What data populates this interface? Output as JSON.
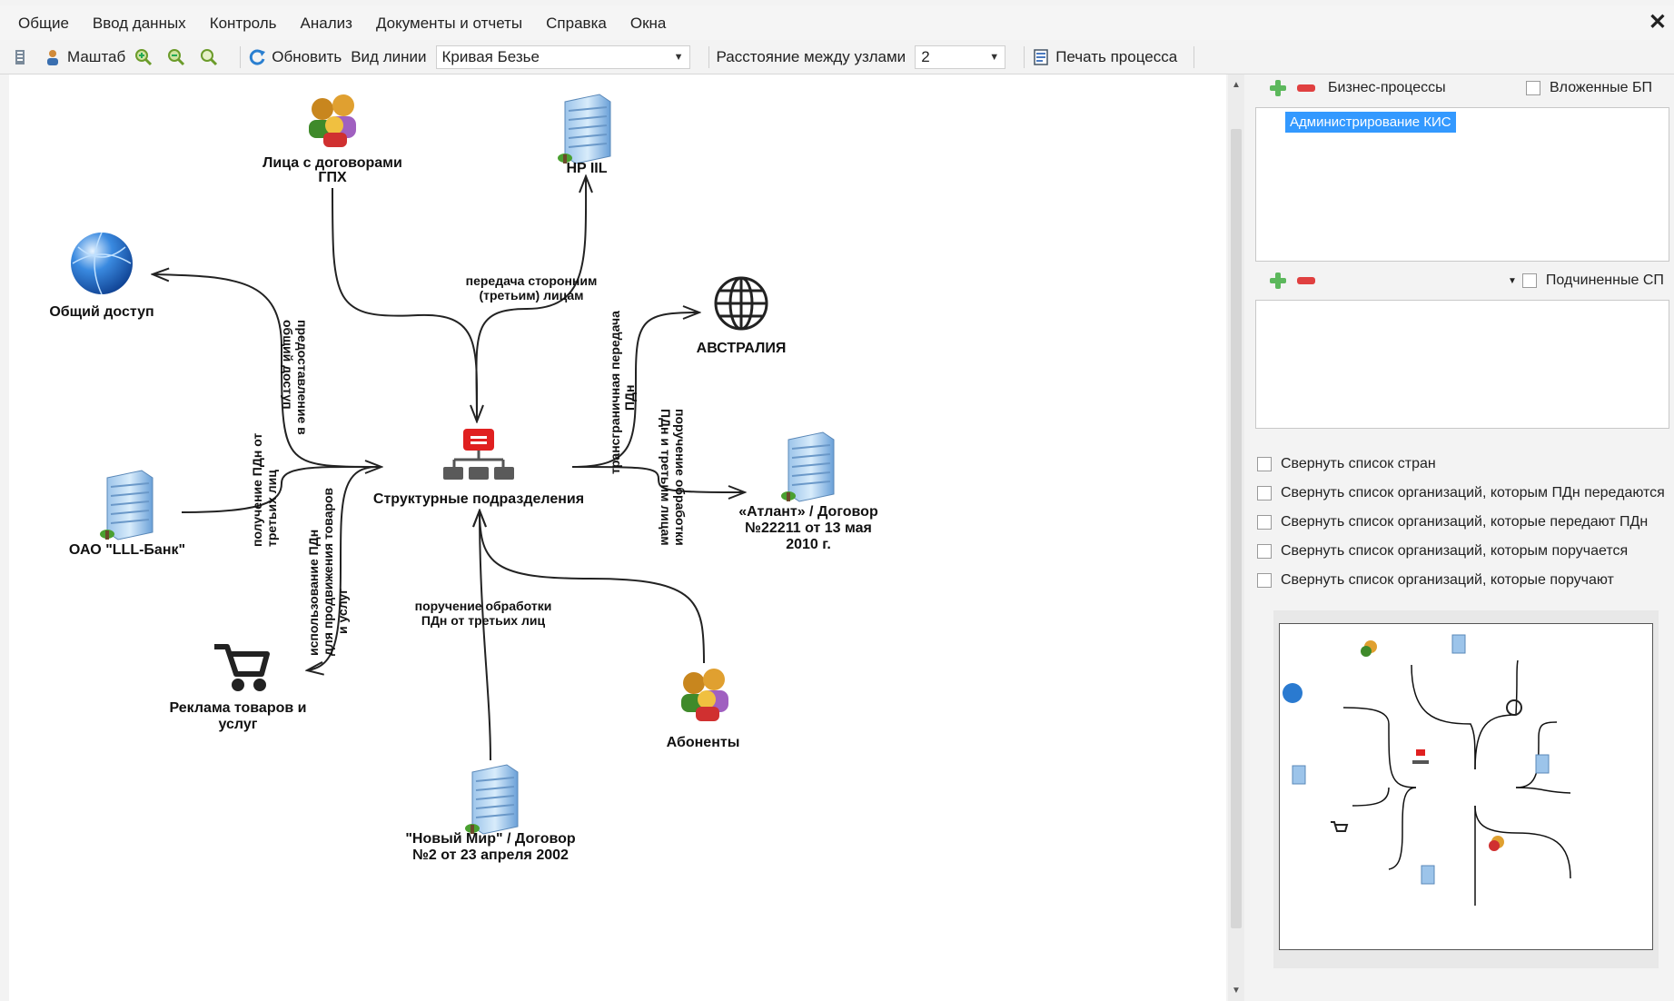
{
  "menu": [
    "Общие",
    "Ввод данных",
    "Контроль",
    "Анализ",
    "Документы и отчеты",
    "Справка",
    "Окна"
  ],
  "toolbar": {
    "scale_label": "Маштаб",
    "refresh_label": "Обновить",
    "line_type_label": "Вид линии",
    "line_type_value": "Кривая Безье",
    "distance_label": "Расстояние между узлами",
    "distance_value": "2",
    "print_label": "Печать процесса"
  },
  "nodes": {
    "center": "Структурные подразделения",
    "gph": [
      "Лица с договорами",
      "ГПХ"
    ],
    "hp": "HP IIL",
    "public": "Общий доступ",
    "australia": "АВСТРАЛИЯ",
    "atlant": [
      "«Атлант» / Договор",
      "№22211 от 13 мая",
      "2010 г."
    ],
    "bank": "ОАО \"LLL-Банк\"",
    "ads": [
      "Реклама товаров и",
      "услуг"
    ],
    "subscribers": "Абоненты",
    "newworld": [
      "\"Новый Мир\" / Договор",
      "№2 от 23 апреля 2002"
    ]
  },
  "edges": {
    "third_party_transfer": [
      "передача сторонним",
      "(третьим) лицам"
    ],
    "public_access": [
      "предоставление в",
      "общий доступ"
    ],
    "receive_pd": [
      "получение ПДн от",
      "третьих лиц"
    ],
    "usage_pd": [
      "использование ПДн",
      "для продвижения товаров",
      "и услуг"
    ],
    "crossborder": [
      "трансграничная передача",
      "ПДн"
    ],
    "commission_to": [
      "поручение обработки",
      "ПДн и третьим лицам"
    ],
    "commission_from": [
      "поручение обработки",
      "ПДн от третьих лиц"
    ]
  },
  "side": {
    "bp_label": "Бизнес-процессы",
    "nested_bp_label": "Вложенные БП",
    "bp_items": [
      "Администрирование КИС"
    ],
    "sub_sp_label": "Подчиненные СП",
    "checkboxes": [
      "Свернуть список стран",
      "Свернуть список организаций, которым ПДн передаются",
      "Свернуть список организаций, которые передают ПДн",
      "Свернуть список организаций, которым поручается",
      "Свернуть список организаций, которые поручают"
    ]
  },
  "colors": {
    "selection": "#3399ff",
    "add": "#5cb85c",
    "remove": "#e04040",
    "org_unit": "#e02020"
  }
}
